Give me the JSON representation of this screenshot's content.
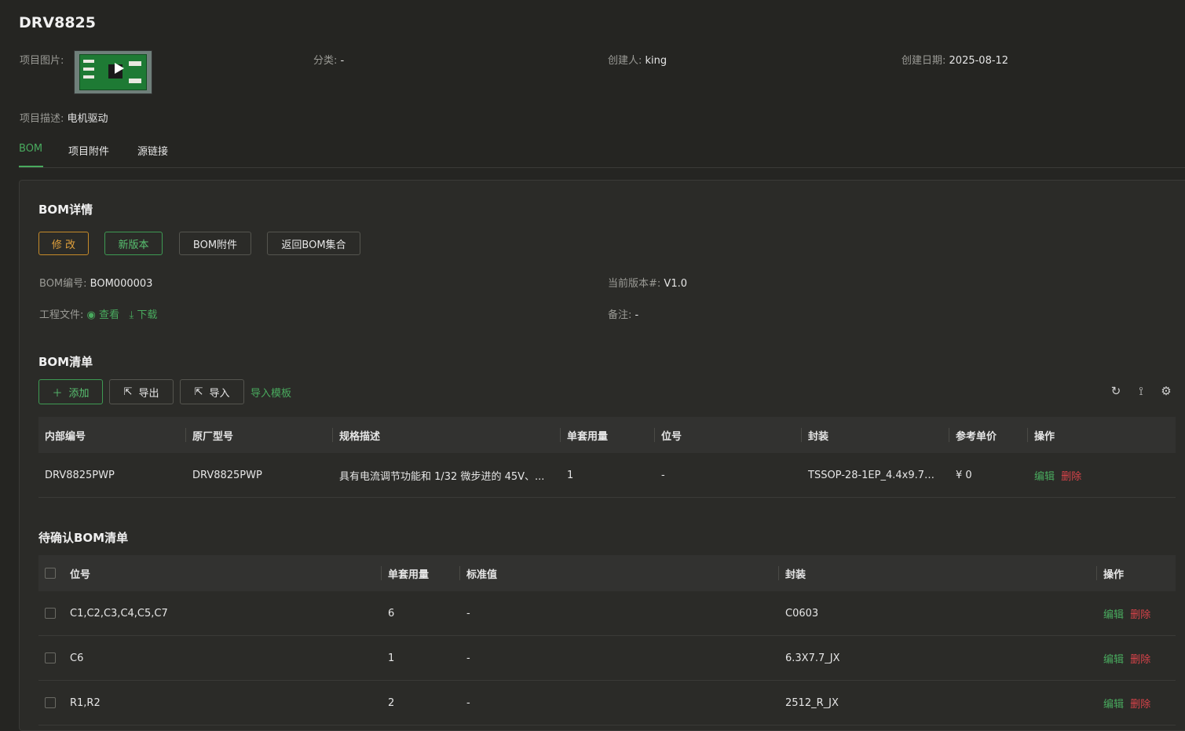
{
  "project": {
    "title": "DRV8825",
    "image_label": "项目图片:",
    "category_label": "分类:",
    "category_value": "-",
    "creator_label": "创建人:",
    "creator_value": "king",
    "created_date_label": "创建日期:",
    "created_date_value": "2025-08-12",
    "desc_label": "项目描述:",
    "desc_value": "电机驱动"
  },
  "tabs": [
    {
      "label": "BOM"
    },
    {
      "label": "项目附件"
    },
    {
      "label": "源链接"
    }
  ],
  "bom_detail": {
    "title": "BOM详情",
    "buttons": {
      "edit": "修 改",
      "new_version": "新版本",
      "attachments": "BOM附件",
      "back": "返回BOM集合"
    },
    "bom_no_label": "BOM编号:",
    "bom_no_value": "BOM000003",
    "version_label": "当前版本#:",
    "version_value": "V1.0",
    "eng_file_label": "工程文件:",
    "view_label": "查看",
    "download_label": "下载",
    "remark_label": "备注:",
    "remark_value": "-"
  },
  "bom_list": {
    "title": "BOM清单",
    "buttons": {
      "add": "添加",
      "export": "导出",
      "import": "导入",
      "template": "导入模板"
    },
    "toolbar_icons": [
      "refresh-icon",
      "column-height-icon",
      "settings-icon"
    ],
    "columns": [
      "内部编号",
      "原厂型号",
      "规格描述",
      "单套用量",
      "位号",
      "封装",
      "参考单价",
      "操作"
    ],
    "rows": [
      {
        "internal_no": "DRV8825PWP",
        "model": "DRV8825PWP",
        "spec": "具有电流调节功能和 1/32 微步进的 45V、...",
        "qty": "1",
        "ref": "-",
        "package": "TSSOP-28-1EP_4.4x9.7m...",
        "price": "¥ 0",
        "edit": "编辑",
        "delete": "删除"
      }
    ]
  },
  "pending_list": {
    "title": "待确认BOM清单",
    "columns": [
      "位号",
      "单套用量",
      "标准值",
      "封装",
      "操作"
    ],
    "rows": [
      {
        "ref": "C1,C2,C3,C4,C5,C7",
        "qty": "6",
        "value": "-",
        "package": "C0603",
        "edit": "编辑",
        "delete": "删除"
      },
      {
        "ref": "C6",
        "qty": "1",
        "value": "-",
        "package": "6.3X7.7_JX",
        "edit": "编辑",
        "delete": "删除"
      },
      {
        "ref": "R1,R2",
        "qty": "2",
        "value": "-",
        "package": "2512_R_JX",
        "edit": "编辑",
        "delete": "删除"
      }
    ]
  },
  "colors": {
    "accent": "#49aa5e",
    "danger": "#d9434a",
    "warning": "#e0a03c",
    "background": "#252522"
  }
}
